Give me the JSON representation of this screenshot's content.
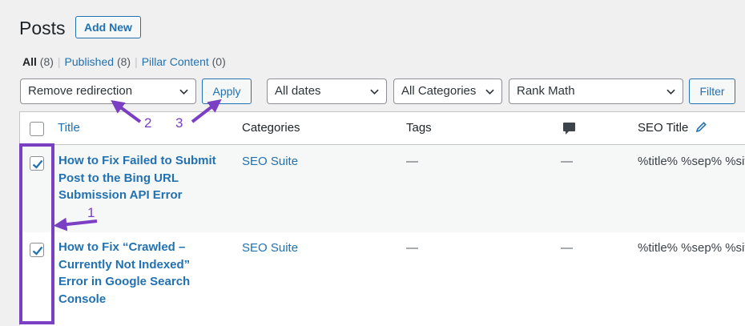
{
  "header": {
    "title": "Posts",
    "add_new_label": "Add New"
  },
  "views": [
    {
      "label": "All",
      "count": "(8)"
    },
    {
      "label": "Published",
      "count": "(8)"
    },
    {
      "label": "Pillar Content",
      "count": "(0)"
    }
  ],
  "filters": {
    "bulk_action": "Remove redirection",
    "apply_label": "Apply",
    "dates": "All dates",
    "categories": "All Categories",
    "seo": "Rank Math",
    "filter_label": "Filter"
  },
  "table": {
    "columns": {
      "title": "Title",
      "categories": "Categories",
      "tags": "Tags",
      "seo_title": "SEO Title"
    },
    "rows": [
      {
        "title_lines": [
          "How to Fix Failed to Submit",
          "Post to the Bing URL",
          "Submission API Error"
        ],
        "category": "SEO Suite",
        "tags": "—",
        "comments": "—",
        "seo_title": "%title% %sep% %site"
      },
      {
        "title_lines": [
          "How to Fix “Crawled –",
          "Currently Not Indexed”",
          "Error in Google Search",
          "Console"
        ],
        "category": "SEO Suite",
        "tags": "—",
        "comments": "—",
        "seo_title": "%title% %sep% %site"
      }
    ]
  },
  "annotations": {
    "a1": "1",
    "a2": "2",
    "a3": "3"
  },
  "colors": {
    "accent": "#2271b1",
    "annotation": "#7b3fc4"
  }
}
